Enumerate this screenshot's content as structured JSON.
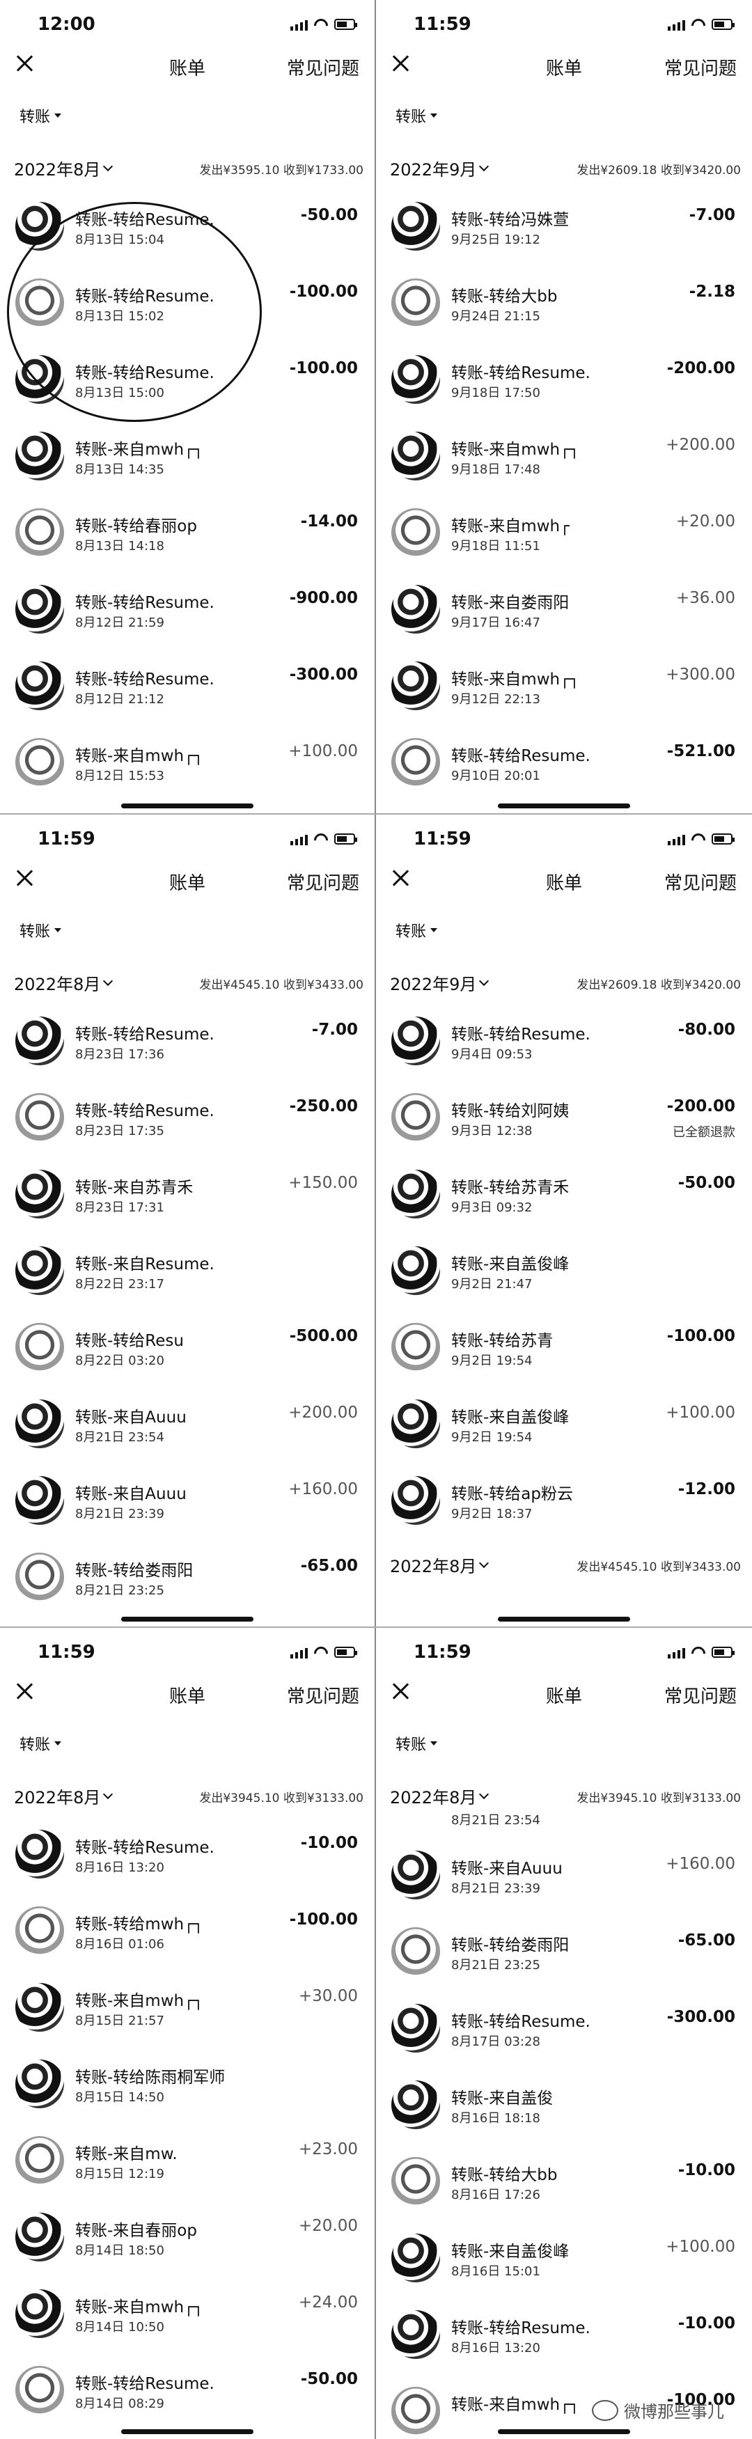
{
  "ui": {
    "title": "账单",
    "help": "常见问题",
    "filter": "转账"
  },
  "panels": [
    {
      "time": "12:00",
      "month": "2022年8月",
      "sum": "发出¥3595.10  收到¥1733.00",
      "rows": [
        {
          "title": "转账-转给Resume.",
          "time": "8月13日 15:04",
          "amount": "-50.00"
        },
        {
          "title": "转账-转给Resume.",
          "time": "8月13日 15:02",
          "amount": "-100.00"
        },
        {
          "title": "转账-转给Resume.",
          "time": "8月13日 15:00",
          "amount": "-100.00"
        },
        {
          "title": "转账-来自mwh┌┐",
          "time": "8月13日 14:35",
          "amount": ""
        },
        {
          "title": "转账-转给春丽op",
          "time": "8月13日 14:18",
          "amount": "-14.00"
        },
        {
          "title": "转账-转给Resume.",
          "time": "8月12日 21:59",
          "amount": "-900.00"
        },
        {
          "title": "转账-转给Resume.",
          "time": "8月12日 21:12",
          "amount": "-300.00"
        },
        {
          "title": "转账-来自mwh┌┐",
          "time": "8月12日 15:53",
          "amount": "+100.00"
        }
      ]
    },
    {
      "time": "11:59",
      "month": "2022年9月",
      "sum": "发出¥2609.18  收到¥3420.00",
      "rows": [
        {
          "title": "转账-转给冯姝萱",
          "time": "9月25日 19:12",
          "amount": "-7.00"
        },
        {
          "title": "转账-转给大bb",
          "time": "9月24日 21:15",
          "amount": "-2.18"
        },
        {
          "title": "转账-转给Resume.",
          "time": "9月18日 17:50",
          "amount": "-200.00"
        },
        {
          "title": "转账-来自mwh┌┐",
          "time": "9月18日 17:48",
          "amount": "+200.00"
        },
        {
          "title": "转账-来自mwh┌",
          "time": "9月18日 11:51",
          "amount": "+20.00"
        },
        {
          "title": "转账-来自娄雨阳",
          "time": "9月17日 16:47",
          "amount": "+36.00"
        },
        {
          "title": "转账-来自mwh┌┐",
          "time": "9月12日 22:13",
          "amount": "+300.00"
        },
        {
          "title": "转账-转给Resume.",
          "time": "9月10日 20:01",
          "amount": "-521.00"
        }
      ]
    },
    {
      "time": "11:59",
      "month": "2022年8月",
      "sum": "发出¥4545.10  收到¥3433.00",
      "rows": [
        {
          "title": "转账-转给Resume.",
          "time": "8月23日 17:36",
          "amount": "-7.00"
        },
        {
          "title": "转账-转给Resume.",
          "time": "8月23日 17:35",
          "amount": "-250.00"
        },
        {
          "title": "转账-来自苏青禾",
          "time": "8月23日 17:31",
          "amount": "+150.00"
        },
        {
          "title": "转账-来自Resume.",
          "time": "8月22日 23:17",
          "amount": ""
        },
        {
          "title": "转账-转给Resu",
          "time": "8月22日 03:20",
          "amount": "-500.00"
        },
        {
          "title": "转账-来自Auuu",
          "time": "8月21日 23:54",
          "amount": "+200.00"
        },
        {
          "title": "转账-来自Auuu",
          "time": "8月21日 23:39",
          "amount": "+160.00"
        },
        {
          "title": "转账-转给娄雨阳",
          "time": "8月21日 23:25",
          "amount": "-65.00"
        }
      ]
    },
    {
      "time": "11:59",
      "month": "2022年9月",
      "sum": "发出¥2609.18  收到¥3420.00",
      "rows": [
        {
          "title": "转账-转给Resume.",
          "time": "9月4日 09:53",
          "amount": "-80.00"
        },
        {
          "title": "转账-转给刘阿姨",
          "time": "9月3日 12:38",
          "amount": "-200.00",
          "status": "已全额退款"
        },
        {
          "title": "转账-转给苏青禾",
          "time": "9月3日 09:32",
          "amount": "-50.00"
        },
        {
          "title": "转账-来自盖俊峰",
          "time": "9月2日 21:47",
          "amount": ""
        },
        {
          "title": "转账-转给苏青",
          "time": "9月2日 19:54",
          "amount": "-100.00"
        },
        {
          "title": "转账-来自盖俊峰",
          "time": "9月2日 19:54",
          "amount": "+100.00"
        },
        {
          "title": "转账-转给ap粉云",
          "time": "9月2日 18:37",
          "amount": "-12.00"
        }
      ],
      "month2": "2022年8月",
      "sum2": "发出¥4545.10  收到¥3433.00"
    },
    {
      "time": "11:59",
      "month": "2022年8月",
      "sum": "发出¥3945.10  收到¥3133.00",
      "rows": [
        {
          "title": "转账-转给Resume.",
          "time": "8月16日 13:20",
          "amount": "-10.00"
        },
        {
          "title": "转账-转给mwh┌┐",
          "time": "8月16日 01:06",
          "amount": "-100.00"
        },
        {
          "title": "转账-来自mwh┌┐",
          "time": "8月15日 21:57",
          "amount": "+30.00"
        },
        {
          "title": "转账-转给陈雨桐军师",
          "time": "8月15日 14:50",
          "amount": ""
        },
        {
          "title": "转账-来自mw.",
          "time": "8月15日 12:19",
          "amount": "+23.00"
        },
        {
          "title": "转账-来自春丽op",
          "time": "8月14日 18:50",
          "amount": "+20.00"
        },
        {
          "title": "转账-来自mwh┌┐",
          "time": "8月14日 10:50",
          "amount": "+24.00"
        },
        {
          "title": "转账-转给Resume.",
          "time": "8月14日 08:29",
          "amount": "-50.00"
        }
      ]
    },
    {
      "time": "11:59",
      "month": "2022年8月",
      "sum": "发出¥3945.10  收到¥3133.00",
      "top_time": "8月21日 23:54",
      "rows": [
        {
          "title": "转账-来自Auuu",
          "time": "8月21日 23:39",
          "amount": "+160.00"
        },
        {
          "title": "转账-转给娄雨阳",
          "time": "8月21日 23:25",
          "amount": "-65.00"
        },
        {
          "title": "转账-转给Resume.",
          "time": "8月17日 03:28",
          "amount": "-300.00"
        },
        {
          "title": "转账-来自盖俊",
          "time": "8月16日 18:18",
          "amount": ""
        },
        {
          "title": "转账-转给大bb",
          "time": "8月16日 17:26",
          "amount": "-10.00"
        },
        {
          "title": "转账-来自盖俊峰",
          "time": "8月16日 15:01",
          "amount": "+100.00"
        },
        {
          "title": "转账-转给Resume.",
          "time": "8月16日 13:20",
          "amount": "-10.00"
        },
        {
          "title": "转账-来自mwh┌┐",
          "time": "",
          "amount": "-100.00"
        }
      ]
    }
  ],
  "watermark": "微博那些事儿"
}
